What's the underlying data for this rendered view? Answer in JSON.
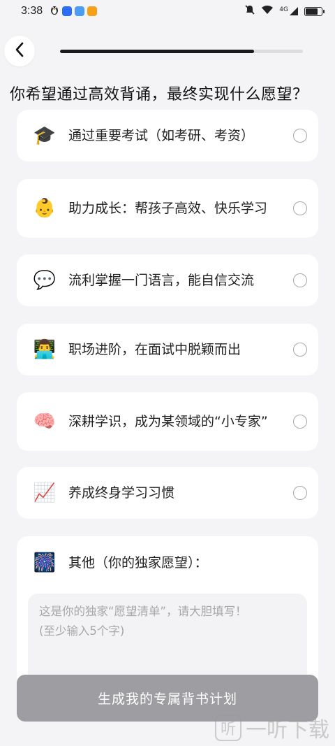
{
  "status_bar": {
    "time": "3:38",
    "network": "4G",
    "icons": [
      "penguin-icon",
      "shield-app-icon",
      "cloud-app-icon",
      "video-app-icon",
      "mute-icon",
      "wifi-icon",
      "signal-icon",
      "battery-icon"
    ]
  },
  "progress": {
    "value": 0.8
  },
  "question": "你希望通过高效背诵，最终实现什么愿望？",
  "options": [
    {
      "emoji": "🎓",
      "icon": "graduation-cap-icon",
      "label": "通过重要考试（如考研、考资）"
    },
    {
      "emoji": "👶",
      "icon": "baby-face-icon",
      "label": "助力成长：帮孩子高效、快乐学习"
    },
    {
      "emoji": "💬",
      "icon": "speech-bubble-icon",
      "label": "流利掌握一门语言，能自信交流"
    },
    {
      "emoji": "👨‍💻",
      "icon": "technologist-icon",
      "label": "职场进阶，在面试中脱颖而出"
    },
    {
      "emoji": "🧠",
      "icon": "brain-icon",
      "label": "深耕学识，成为某领域的“小专家”"
    },
    {
      "emoji": "📈",
      "icon": "chart-up-icon",
      "label": "养成终身学习习惯"
    }
  ],
  "other": {
    "emoji": "🎆",
    "label": "其他（你的独家愿望）：",
    "placeholder_line1": "这是你的独家“愿望清单”，请大胆填写！",
    "placeholder_line2": "(至少输入5个字)"
  },
  "submit_label": "生成我的专属背书计划",
  "watermark": {
    "logo": "听",
    "text": "一听下载"
  },
  "colors": {
    "background": "#f4f4f6",
    "card": "#ffffff",
    "progress_fill": "#1a1a1a",
    "button_disabled": "#9e9ea2"
  }
}
